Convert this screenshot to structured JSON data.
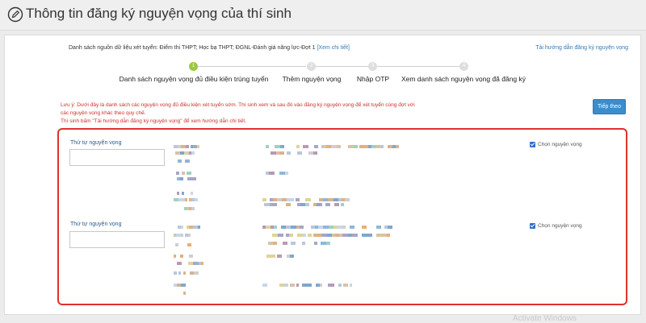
{
  "header": {
    "title": "Thông tin đăng ký nguyện vọng của thí sinh"
  },
  "source": {
    "text": "Danh sách nguồn dữ liệu xét tuyển: Điểm thi THPT; Học bạ THPT; ĐGNL-Đánh giá năng lực-Đợt 1",
    "link": "[Xem chi tiết]"
  },
  "guide_link": "Tải hướng dẫn đăng ký nguyện vọng",
  "wizard": {
    "steps": [
      {
        "num": "1",
        "label": "Danh sách nguyện vọng đủ điều kiện trúng tuyển",
        "active": true
      },
      {
        "num": "2",
        "label": "Thêm nguyện vọng",
        "active": false
      },
      {
        "num": "3",
        "label": "Nhập OTP",
        "active": false
      },
      {
        "num": "4",
        "label": "Xem danh sách nguyện vọng đã đăng ký",
        "active": false
      }
    ]
  },
  "note": {
    "line1": "Lưu ý: Dưới đây là danh sách các nguyện vọng đủ điều kiện xét tuyển sớm. Thí sinh xem và sau đó vào đăng ký nguyện vọng để xét tuyển cùng đợt với",
    "line2": "các nguyện vọng khác theo quy chế.",
    "line3": "Thí sinh bấm \"Tải hướng dẫn đăng ký nguyện vọng\" để xem hướng dẫn chi tiết."
  },
  "next_button": "Tiếp theo",
  "aspirations": [
    {
      "priority_label": "Thứ tự nguyện vọng",
      "priority_value": "",
      "choose_label": "Chọn nguyện vọng",
      "checked": true
    },
    {
      "priority_label": "Thứ tự nguyện vọng",
      "priority_value": "",
      "choose_label": "Chọn nguyện vọng",
      "checked": true
    }
  ],
  "watermark": "Activate Windows"
}
